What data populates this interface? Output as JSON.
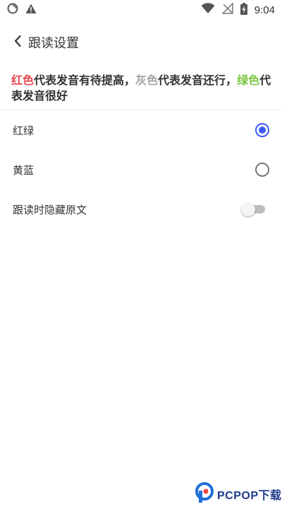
{
  "status_bar": {
    "time": "9:04",
    "icons": [
      "sync-circle-icon",
      "warning-icon",
      "wifi-icon",
      "no-signal-icon",
      "battery-charging-icon"
    ]
  },
  "header": {
    "back_icon": "chevron-left-icon",
    "title": "跟读设置"
  },
  "legend": {
    "red_word": "红色",
    "red_desc": "代表发音有待提高，",
    "gray_word": "灰色",
    "gray_desc": "代表发音还行，",
    "green_word": "绿色",
    "green_desc": "代表发音很好",
    "colors": {
      "red": "#e5484d",
      "gray": "#a3a3a3",
      "green": "#7bc542"
    }
  },
  "options": [
    {
      "label": "红绿",
      "selected": true
    },
    {
      "label": "黄蓝",
      "selected": false
    }
  ],
  "hide_text": {
    "label": "跟读时隐藏原文",
    "enabled": false
  },
  "accent_color": "#3d5afe",
  "watermark": {
    "text": "PCPOP下载"
  }
}
